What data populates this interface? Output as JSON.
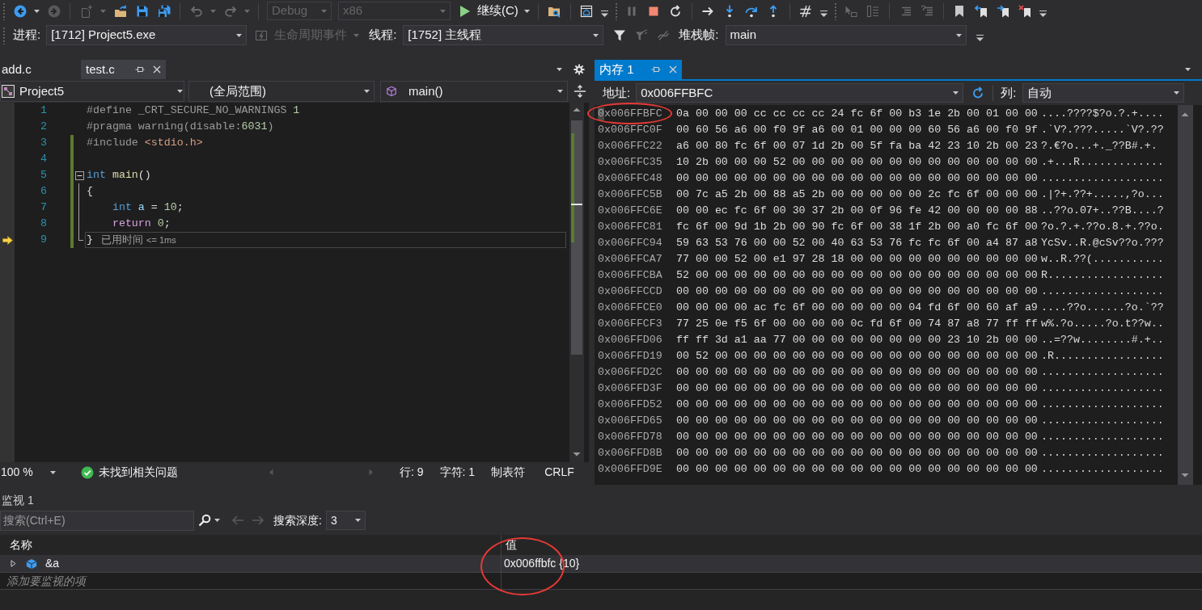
{
  "toolbar": [
    {
      "kind": "grip"
    },
    {
      "kind": "back",
      "disabled": false
    },
    {
      "kind": "caret",
      "disabled": false
    },
    {
      "kind": "forward",
      "disabled": true
    },
    {
      "kind": "separator"
    },
    {
      "kind": "new",
      "disabled": true
    },
    {
      "kind": "caret",
      "disabled": true
    },
    {
      "kind": "open",
      "disabled": false
    },
    {
      "kind": "save",
      "disabled": false
    },
    {
      "kind": "saveall",
      "disabled": false
    },
    {
      "kind": "separator"
    },
    {
      "kind": "undo",
      "disabled": true
    },
    {
      "kind": "caret",
      "disabled": true
    },
    {
      "kind": "redo",
      "disabled": true
    },
    {
      "kind": "caret",
      "disabled": true
    },
    {
      "kind": "separator"
    },
    {
      "kind": "configuration",
      "value": "Debug",
      "disabled": true
    },
    {
      "kind": "platform",
      "value": "x86",
      "disabled": true
    },
    {
      "kind": "continue",
      "label": "继续(C)",
      "disabled": false
    },
    {
      "kind": "caret",
      "disabled": false
    },
    {
      "kind": "separator"
    },
    {
      "kind": "findfolder",
      "disabled": false
    },
    {
      "kind": "separator"
    },
    {
      "kind": "window",
      "disabled": false
    },
    {
      "kind": "overflow",
      "disabled": false
    },
    {
      "kind": "grip"
    },
    {
      "kind": "pause",
      "disabled": true
    },
    {
      "kind": "stop",
      "disabled": false
    },
    {
      "kind": "restart",
      "disabled": false
    },
    {
      "kind": "separator"
    },
    {
      "kind": "shownext",
      "disabled": false
    },
    {
      "kind": "stepinto",
      "disabled": false
    },
    {
      "kind": "stepover",
      "disabled": false
    },
    {
      "kind": "stepout",
      "disabled": false
    },
    {
      "kind": "separator"
    },
    {
      "kind": "hex",
      "disabled": false
    },
    {
      "kind": "overflow",
      "disabled": false
    },
    {
      "kind": "grip"
    },
    {
      "kind": "pointer",
      "disabled": true
    },
    {
      "kind": "columns",
      "disabled": true
    },
    {
      "kind": "separator"
    },
    {
      "kind": "indent",
      "disabled": true
    },
    {
      "kind": "comment",
      "disabled": true
    },
    {
      "kind": "separator"
    },
    {
      "kind": "bookmark",
      "disabled": false
    },
    {
      "kind": "bookmarkprev",
      "disabled": false
    },
    {
      "kind": "bookmarknext",
      "disabled": false
    },
    {
      "kind": "bookmarkclear",
      "disabled": false
    },
    {
      "kind": "overflow",
      "disabled": false
    }
  ],
  "debug_bar": {
    "process": {
      "label": "进程:",
      "value": "[1712] Project5.exe"
    },
    "lifecycle": {
      "label": "生命周期事件",
      "disabled": true
    },
    "thread": {
      "label": "线程:",
      "value": "[1752] 主线程"
    },
    "filters": [
      {
        "kind": "filter",
        "disabled": false
      },
      {
        "kind": "filterclear",
        "disabled": true
      },
      {
        "kind": "chain",
        "disabled": true
      }
    ],
    "stack_frame": {
      "label": "堆栈帧:",
      "value": "main"
    }
  },
  "editor": {
    "tabs": [
      {
        "label": "add.c",
        "selected": false
      },
      {
        "label": "test.c",
        "selected": true
      }
    ],
    "navigation": {
      "project": "Project5",
      "scope": "(全局范围)",
      "member": "main()"
    },
    "lines": [
      {
        "number": "1",
        "changed": false,
        "current": false,
        "tokens": [
          {
            "kind": "directive",
            "text": "#define _CRT_SECURE_NO_WARNINGS "
          },
          {
            "kind": "number",
            "text": "1"
          }
        ]
      },
      {
        "number": "2",
        "changed": false,
        "current": false,
        "tokens": [
          {
            "kind": "directive",
            "text": "#pragma warning(disable:"
          },
          {
            "kind": "number",
            "text": "6031"
          },
          {
            "kind": "directive",
            "text": ")"
          }
        ]
      },
      {
        "number": "3",
        "changed": true,
        "current": false,
        "tokens": [
          {
            "kind": "directive",
            "text": "#include "
          },
          {
            "kind": "string",
            "text": "<stdio.h>"
          }
        ]
      },
      {
        "number": "4",
        "changed": true,
        "current": false
      },
      {
        "number": "5",
        "changed": true,
        "current": false,
        "expanded": true,
        "tokens": [
          {
            "kind": "keyword",
            "text": "int"
          },
          {
            "kind": "function",
            "text": " main"
          },
          {
            "kind": "plain",
            "text": "()"
          }
        ],
        "children": [
          {
            "number": "6",
            "changed": true,
            "current": false,
            "tokens": [
              {
                "kind": "plain",
                "text": "{"
              }
            ]
          },
          {
            "number": "7",
            "changed": true,
            "current": false,
            "tokens": [
              {
                "kind": "keyword",
                "text": "    int"
              },
              {
                "kind": "variable",
                "text": " a"
              },
              {
                "kind": "plain",
                "text": " = "
              },
              {
                "kind": "number",
                "text": "10"
              },
              {
                "kind": "plain",
                "text": ";"
              }
            ]
          },
          {
            "number": "8",
            "changed": true,
            "current": false,
            "tokens": [
              {
                "kind": "control",
                "text": "    return"
              },
              {
                "kind": "number",
                "text": " 0"
              },
              {
                "kind": "plain",
                "text": ";"
              }
            ]
          },
          {
            "number": "9",
            "changed": true,
            "current": true,
            "tokens": [
              {
                "kind": "plain",
                "text": "}"
              }
            ],
            "elapsed": {
              "label": "已用时间",
              "value": "<= 1ms"
            }
          }
        ]
      }
    ],
    "status_bar": {
      "zoom": "100 %",
      "issues": "未找到相关问题",
      "line": "行: 9",
      "column": "字符: 1",
      "indent": "制表符",
      "line_ending": "CRLF"
    }
  },
  "memory": {
    "tab": {
      "label": "内存 1",
      "selected": true
    },
    "address_label": "地址:",
    "address": "0x006FFBFC",
    "columns_label": "列:",
    "columns": "自动",
    "rows": [
      {
        "address": "0x006FFBFC",
        "bytes": "0a 00 00 00 cc cc cc cc 24 fc 6f 00 b3 1e 2b 00 01 00 00",
        "ascii": "....????$?o.?.+....",
        "cursor": true,
        "circled": true
      },
      {
        "address": "0x006FFC0F",
        "bytes": "00 60 56 a6 00 f0 9f a6 00 01 00 00 00 60 56 a6 00 f0 9f",
        "ascii": ".`V?.???.....`V?.??",
        "cursor": false,
        "circled": false
      },
      {
        "address": "0x006FFC22",
        "bytes": "a6 00 80 fc 6f 00 07 1d 2b 00 5f fa ba 42 23 10 2b 00 23",
        "ascii": "?.€?o...+._??B#.+.",
        "cursor": false,
        "circled": false
      },
      {
        "address": "0x006FFC35",
        "bytes": "10 2b 00 00 00 52 00 00 00 00 00 00 00 00 00 00 00 00 00",
        "ascii": ".+...R.............",
        "cursor": false,
        "circled": false
      },
      {
        "address": "0x006FFC48",
        "bytes": "00 00 00 00 00 00 00 00 00 00 00 00 00 00 00 00 00 00 00",
        "ascii": "...................",
        "cursor": false,
        "circled": false
      },
      {
        "address": "0x006FFC5B",
        "bytes": "00 7c a5 2b 00 88 a5 2b 00 00 00 00 00 2c fc 6f 00 00 00",
        "ascii": ".|?+.??+.....,?o...",
        "cursor": false,
        "circled": false
      },
      {
        "address": "0x006FFC6E",
        "bytes": "00 00 ec fc 6f 00 30 37 2b 00 0f 96 fe 42 00 00 00 00 88",
        "ascii": "..??o.07+..??B....?",
        "cursor": false,
        "circled": false
      },
      {
        "address": "0x006FFC81",
        "bytes": "fc 6f 00 9d 1b 2b 00 90 fc 6f 00 38 1f 2b 00 a0 fc 6f 00",
        "ascii": "?o.?.+.??o.8.+.??o.",
        "cursor": false,
        "circled": false
      },
      {
        "address": "0x006FFC94",
        "bytes": "59 63 53 76 00 00 52 00 40 63 53 76 fc fc 6f 00 a4 87 a8",
        "ascii": "YcSv..R.@cSv??o.???",
        "cursor": false,
        "circled": false
      },
      {
        "address": "0x006FFCA7",
        "bytes": "77 00 00 52 00 e1 97 28 18 00 00 00 00 00 00 00 00 00 00",
        "ascii": "w..R.??(...........",
        "cursor": false,
        "circled": false
      },
      {
        "address": "0x006FFCBA",
        "bytes": "52 00 00 00 00 00 00 00 00 00 00 00 00 00 00 00 00 00 00",
        "ascii": "R..................",
        "cursor": false,
        "circled": false
      },
      {
        "address": "0x006FFCCD",
        "bytes": "00 00 00 00 00 00 00 00 00 00 00 00 00 00 00 00 00 00 00",
        "ascii": "...................",
        "cursor": false,
        "circled": false
      },
      {
        "address": "0x006FFCE0",
        "bytes": "00 00 00 00 ac fc 6f 00 00 00 00 00 04 fd 6f 00 60 af a9",
        "ascii": "....??o......?o.`??",
        "cursor": false,
        "circled": false
      },
      {
        "address": "0x006FFCF3",
        "bytes": "77 25 0e f5 6f 00 00 00 00 0c fd 6f 00 74 87 a8 77 ff ff",
        "ascii": "w%.?o.....?o.t??w..",
        "cursor": false,
        "circled": false
      },
      {
        "address": "0x006FFD06",
        "bytes": "ff ff 3d a1 aa 77 00 00 00 00 00 00 00 00 23 10 2b 00 00",
        "ascii": "..=??w........#.+..",
        "cursor": false,
        "circled": false
      },
      {
        "address": "0x006FFD19",
        "bytes": "00 52 00 00 00 00 00 00 00 00 00 00 00 00 00 00 00 00 00",
        "ascii": ".R.................",
        "cursor": false,
        "circled": false
      },
      {
        "address": "0x006FFD2C",
        "bytes": "00 00 00 00 00 00 00 00 00 00 00 00 00 00 00 00 00 00 00",
        "ascii": "...................",
        "cursor": false,
        "circled": false
      },
      {
        "address": "0x006FFD3F",
        "bytes": "00 00 00 00 00 00 00 00 00 00 00 00 00 00 00 00 00 00 00",
        "ascii": "...................",
        "cursor": false,
        "circled": false
      },
      {
        "address": "0x006FFD52",
        "bytes": "00 00 00 00 00 00 00 00 00 00 00 00 00 00 00 00 00 00 00",
        "ascii": "...................",
        "cursor": false,
        "circled": false
      },
      {
        "address": "0x006FFD65",
        "bytes": "00 00 00 00 00 00 00 00 00 00 00 00 00 00 00 00 00 00 00",
        "ascii": "...................",
        "cursor": false,
        "circled": false
      },
      {
        "address": "0x006FFD78",
        "bytes": "00 00 00 00 00 00 00 00 00 00 00 00 00 00 00 00 00 00 00",
        "ascii": "...................",
        "cursor": false,
        "circled": false
      },
      {
        "address": "0x006FFD8B",
        "bytes": "00 00 00 00 00 00 00 00 00 00 00 00 00 00 00 00 00 00 00",
        "ascii": "...................",
        "cursor": false,
        "circled": false
      },
      {
        "address": "0x006FFD9E",
        "bytes": "00 00 00 00 00 00 00 00 00 00 00 00 00 00 00 00 00 00 00",
        "ascii": "...................",
        "cursor": false,
        "circled": false
      }
    ]
  },
  "watch": {
    "title": "监视 1",
    "search": {
      "placeholder": "搜索(Ctrl+E)"
    },
    "history": [
      {
        "kind": "back",
        "disabled": true
      },
      {
        "kind": "forward",
        "disabled": true
      }
    ],
    "depth": {
      "label": "搜索深度:",
      "value": "3"
    },
    "columns": [
      "名称",
      "值"
    ],
    "rows": [
      {
        "name": "&a",
        "value": "0x006ffbfc {10}",
        "expanded": false,
        "circled": true
      }
    ],
    "add": {
      "placeholder": "添加要监视的项"
    }
  }
}
